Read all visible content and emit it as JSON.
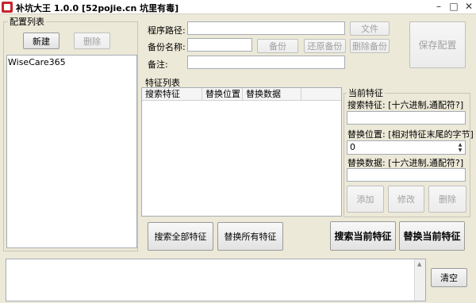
{
  "window": {
    "title": "补坑大王 1.0.0  [52pojie.cn 坑里有毒]",
    "minimize": "–",
    "maximize": "□",
    "close": "✕"
  },
  "config_panel": {
    "group_title": "配置列表",
    "new_button": "新建",
    "delete_button": "删除",
    "items": [
      "WiseCare365"
    ]
  },
  "form": {
    "path_label": "程序路径:",
    "path_value": "",
    "file_button": "文件",
    "backup_name_label": "备份名称:",
    "backup_name_value": "",
    "backup_button": "备份",
    "restore_button": "还原备份",
    "delete_backup_button": "删除备份",
    "note_label": "备注:",
    "note_value": "",
    "save_config_button": "保存配置"
  },
  "feature_list": {
    "group_title": "特征列表",
    "columns": [
      "搜索特征",
      "替换位置",
      "替换数据"
    ],
    "rows": []
  },
  "current_feature": {
    "group_title": "当前特征",
    "search_label": "搜索特征: [十六进制,通配符?]",
    "search_value": "",
    "position_label": "替换位置: [相对特征末尾的字节]",
    "position_value": "0",
    "data_label": "替换数据: [十六进制,通配符?]",
    "data_value": "",
    "add_button": "添加",
    "modify_button": "修改",
    "delete_button": "删除"
  },
  "actions": {
    "search_all": "搜索全部特征",
    "replace_all": "替换所有特征",
    "search_current": "搜索当前特征",
    "replace_current": "替换当前特征"
  },
  "log": {
    "clear_button": "清空"
  }
}
